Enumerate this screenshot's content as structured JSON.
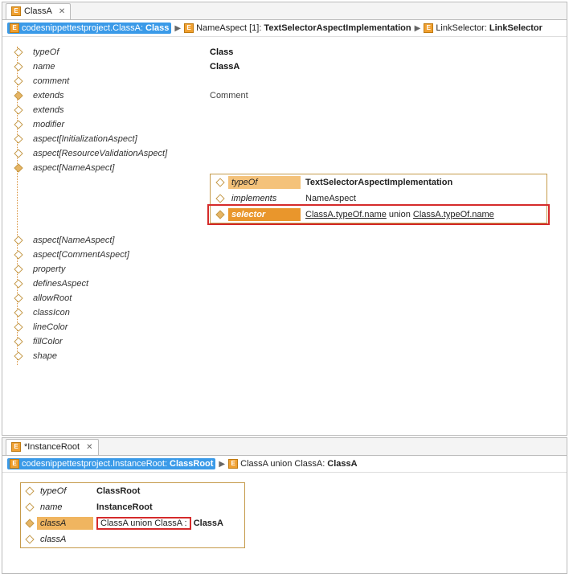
{
  "top": {
    "tab": "ClassA",
    "breadcrumb": {
      "c1_pre": "codesnippettestproject.ClassA:",
      "c1_bold": "Class",
      "c2_pre": "NameAspect [1]:",
      "c2_bold": "TextSelectorAspectImplementation",
      "c3_pre": "LinkSelector:",
      "c3_bold": "LinkSelector"
    },
    "props": {
      "typeOf": {
        "label": "typeOf",
        "value": "Class"
      },
      "name": {
        "label": "name",
        "value": "ClassA"
      },
      "comment": {
        "label": "comment",
        "value": ""
      },
      "extends1": {
        "label": "extends",
        "value": "Comment"
      },
      "extends2": {
        "label": "extends",
        "value": ""
      },
      "modifier": {
        "label": "modifier",
        "value": ""
      },
      "aspectInit": {
        "label": "aspect[InitializationAspect]",
        "value": ""
      },
      "aspectResVal": {
        "label": "aspect[ResourceValidationAspect]",
        "value": ""
      },
      "aspectName1": {
        "label": "aspect[NameAspect]",
        "value": ""
      },
      "aspectName2": {
        "label": "aspect[NameAspect]",
        "value": ""
      },
      "aspectComment": {
        "label": "aspect[CommentAspect]",
        "value": ""
      },
      "property": {
        "label": "property",
        "value": ""
      },
      "definesAspect": {
        "label": "definesAspect",
        "value": ""
      },
      "allowRoot": {
        "label": "allowRoot",
        "value": ""
      },
      "classIcon": {
        "label": "classIcon",
        "value": ""
      },
      "lineColor": {
        "label": "lineColor",
        "value": ""
      },
      "fillColor": {
        "label": "fillColor",
        "value": ""
      },
      "shape": {
        "label": "shape",
        "value": ""
      }
    },
    "nested": {
      "typeOf": {
        "label": "typeOf",
        "value": "TextSelectorAspectImplementation"
      },
      "implements": {
        "label": "implements",
        "value": "NameAspect"
      },
      "selector": {
        "label": "selector",
        "v_link1": "ClassA.typeOf.name",
        "v_mid": " union ",
        "v_link2": "ClassA.typeOf.name"
      }
    }
  },
  "bottom": {
    "tab": "*InstanceRoot",
    "breadcrumb": {
      "c1_pre": "codesnippettestproject.InstanceRoot:",
      "c1_bold": "ClassRoot",
      "c2_pre": "ClassA union ClassA:",
      "c2_bold": "ClassA"
    },
    "props": {
      "typeOf": {
        "label": "typeOf",
        "value": "ClassRoot"
      },
      "name": {
        "label": "name",
        "value": "InstanceRoot"
      },
      "classA1": {
        "label": "classA",
        "boxed": "ClassA union ClassA  :",
        "after": "ClassA"
      },
      "classA2": {
        "label": "classA",
        "value": ""
      }
    }
  }
}
